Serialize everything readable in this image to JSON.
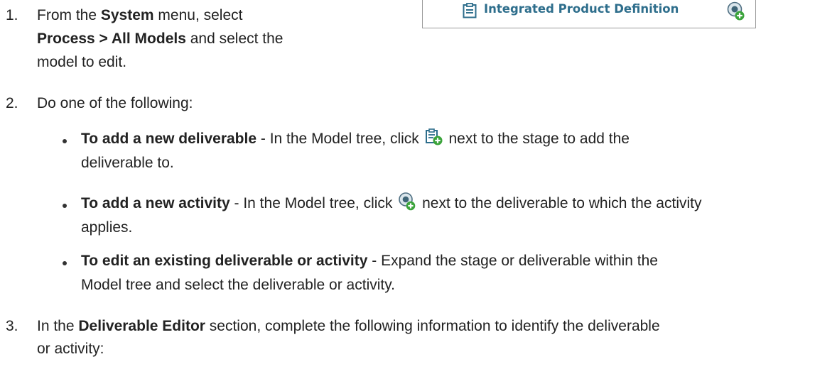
{
  "tree": {
    "item_label": "Integrated Product Definition",
    "doc_icon": "clipboard-icon",
    "add_icon": "add-activity-icon"
  },
  "steps": [
    {
      "num": "1.",
      "line1_a": "From the ",
      "line1_b": "System",
      "line1_c": " menu, select",
      "line2_a": "Process > All Models",
      "line2_b": " and select the",
      "line3": "model to edit."
    },
    {
      "num": "2.",
      "text": "Do one of the following:"
    },
    {
      "num": "3.",
      "line1_a": "In the ",
      "line1_b": "Deliverable Editor",
      "line1_c": " section, complete the following information to identify the deliverable",
      "line2": "or activity:"
    }
  ],
  "bullets": [
    {
      "bold": "To add a new deliverable",
      "text_a": " - In the Model tree, click ",
      "text_b": " next to the stage to add the",
      "text_c": "deliverable to.",
      "icon": "add-deliverable-icon"
    },
    {
      "bold": "To add a new activity",
      "text_a": " - In the Model tree, click ",
      "text_b": " next to the deliverable to which the activity",
      "text_c": "applies.",
      "icon": "add-activity-icon"
    },
    {
      "bold": "To edit an existing deliverable or activity",
      "text_a": " - Expand the stage or deliverable within the",
      "text_c": "Model tree and select the deliverable or activity."
    }
  ]
}
